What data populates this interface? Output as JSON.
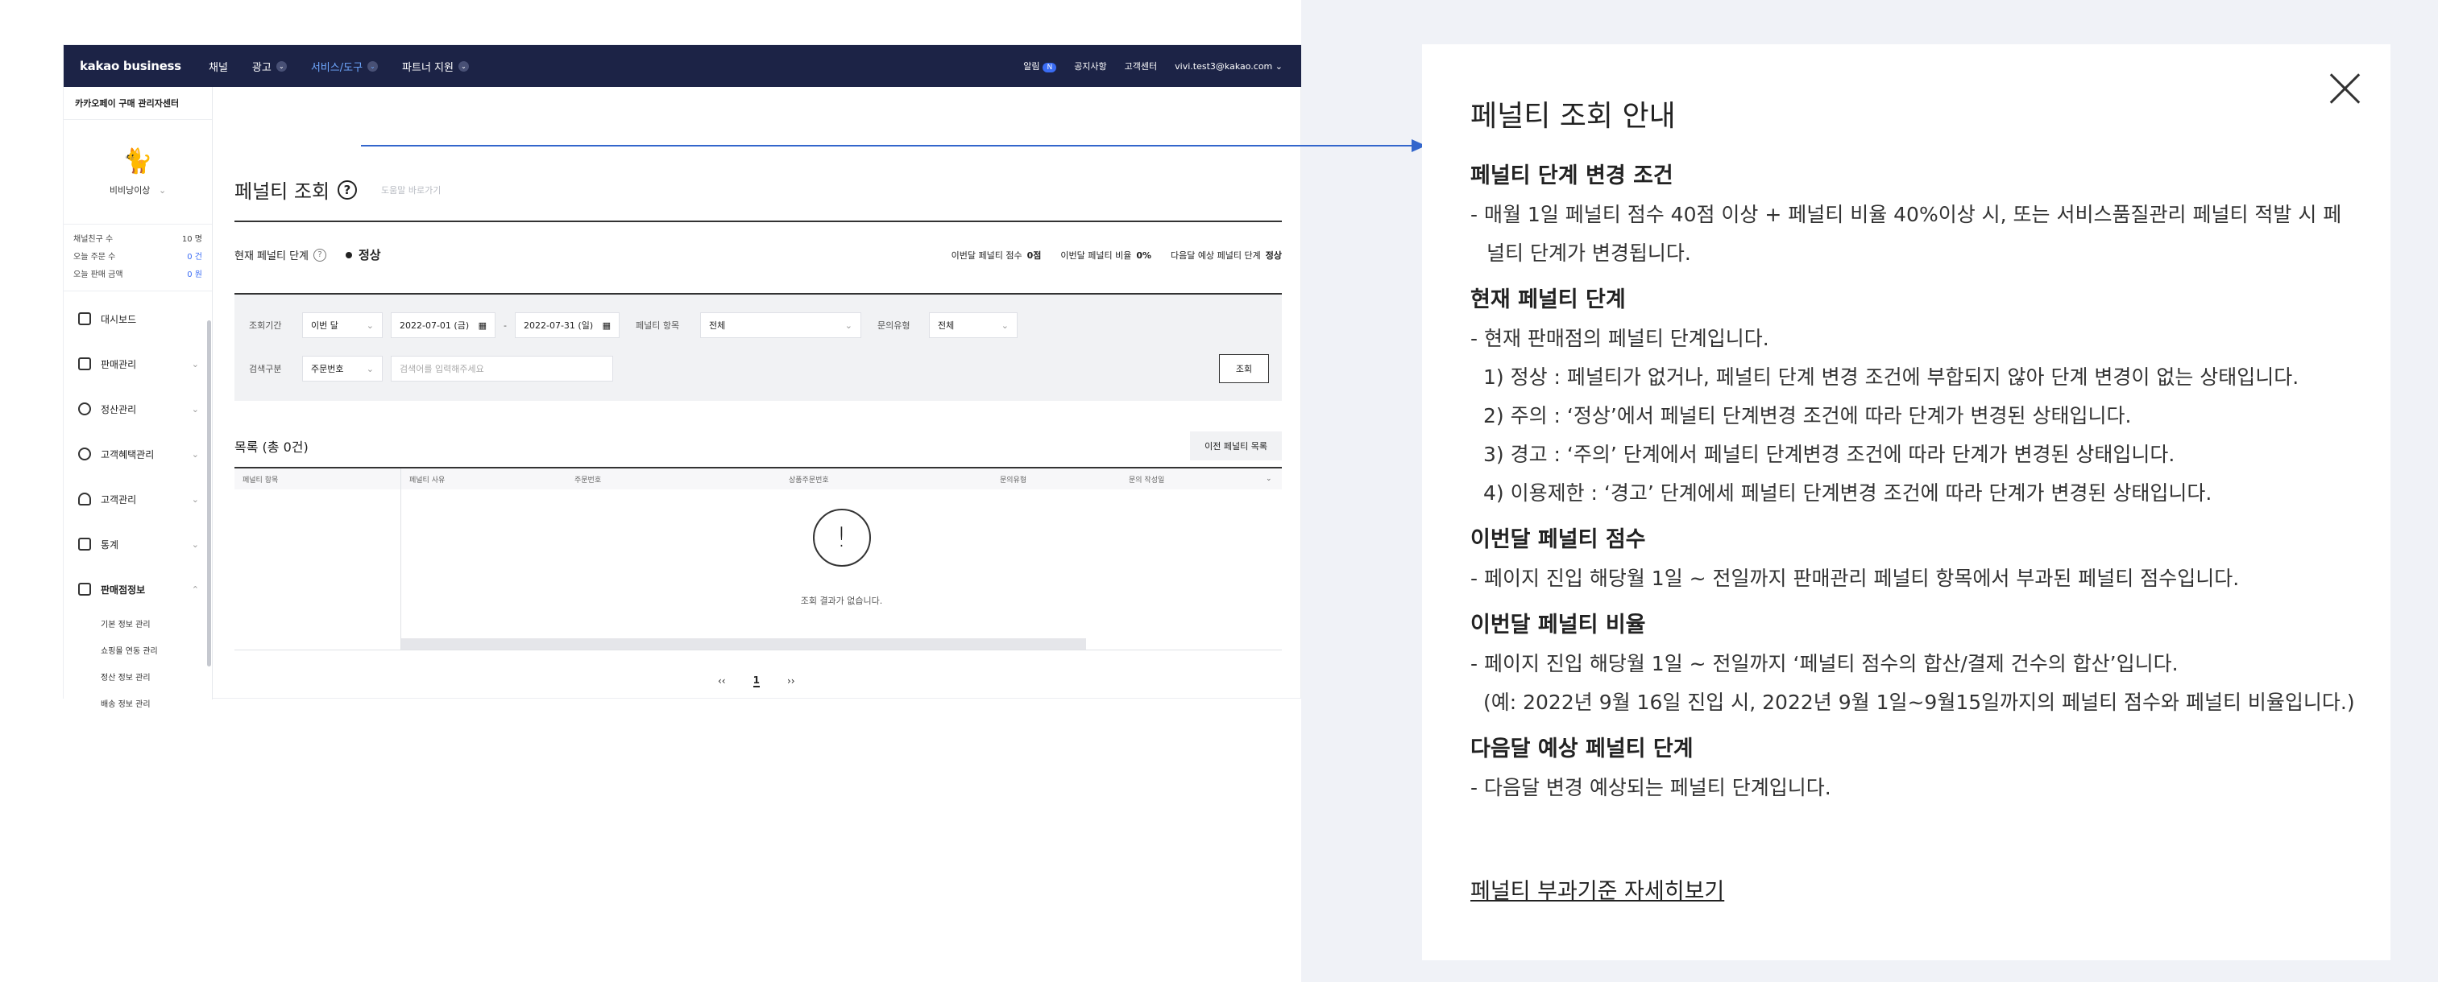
{
  "app": {
    "brand": "kakao business",
    "gnb": [
      {
        "label": "채널",
        "chevron": false,
        "active": false
      },
      {
        "label": "광고",
        "chevron": true,
        "active": false
      },
      {
        "label": "서비스/도구",
        "chevron": true,
        "active": true
      },
      {
        "label": "파트너 지원",
        "chevron": true,
        "active": false
      }
    ],
    "util": {
      "alarm_label": "알림",
      "alarm_count": "N",
      "notice": "공지사항",
      "support": "고객센터",
      "account": "vivi.test3@kakao.com"
    },
    "sidebar": {
      "title": "카카오페이 구매 관리자센터",
      "nickname": "비비낭이상",
      "stats": [
        {
          "label": "채널친구 수",
          "value": "10 명",
          "blue": false
        },
        {
          "label": "오늘 주문 수",
          "value": "0 건",
          "blue": true
        },
        {
          "label": "오늘 판매 금액",
          "value": "0 원",
          "blue": true
        }
      ],
      "menu": [
        {
          "label": "대시보드"
        },
        {
          "label": "판매관리"
        },
        {
          "label": "정산관리"
        },
        {
          "label": "고객혜택관리"
        },
        {
          "label": "고객관리"
        },
        {
          "label": "통계"
        },
        {
          "label": "판매점정보"
        }
      ],
      "submenu": [
        "기본 정보 관리",
        "쇼핑몰 연동 관리",
        "정산 정보 관리",
        "배송 정보 관리"
      ]
    },
    "page": {
      "title": "페널티 조회",
      "faint_link": "도움말 바로가기",
      "status_label": "현재 페널티 단계",
      "status_value": "정상",
      "month_score_label": "이번달 페널티 점수",
      "month_score": "0점",
      "month_ratio_label": "이번달 페널티 비율",
      "month_ratio": "0%",
      "next_level_label": "다음달 예상 페널티 단계",
      "next_level": "정상"
    },
    "filter": {
      "period_label": "조회기간",
      "period_value": "이번 달",
      "date_from": "2022-07-01 (금)",
      "date_sep": "-",
      "date_to": "2022-07-31 (일)",
      "penalty_item_label": "페널티 항목",
      "penalty_item_value": "전체",
      "inquiry_type_label": "문의유형",
      "inquiry_type_value": "전체",
      "search_type_label": "검색구분",
      "search_type_value": "주문번호",
      "search_placeholder": "검색어를 입력해주세요",
      "search_button": "조회"
    },
    "list": {
      "title": "목록 (총 0건)",
      "prev_button": "이전 페널티 목록",
      "columns": [
        "페널티 항목",
        "페널티 사유",
        "주문번호",
        "상품주문번호",
        "문의유형",
        "문의 작성일"
      ],
      "empty_text": "조회 결과가 없습니다.",
      "pager": {
        "prev": "‹‹",
        "page": "1",
        "next": "››"
      }
    }
  },
  "panel": {
    "title": "페널티 조회 안내",
    "sections": [
      {
        "heading": "페널티 단계 변경 조건",
        "lines": [
          "- 매월 1일 페널티 점수 40점 이상 + 페널티 비율 40%이상 시, 또는 서비스품질관리 페널티 적발 시 페",
          "널티 단계가 변경됩니다."
        ]
      },
      {
        "heading": "현재 페널티 단계",
        "lines": [
          "- 현재 판매점의 페널티 단계입니다.",
          "1) 정상 : 페널티가 없거나, 페널티 단계 변경 조건에 부합되지 않아 단계 변경이 없는 상태입니다.",
          "2) 주의 : ‘정상’에서 페널티 단계변경 조건에 따라 단계가 변경된 상태입니다.",
          "3) 경고 : ‘주의’ 단계에서 페널티 단계변경 조건에 따라 단계가 변경된 상태입니다.",
          "4) 이용제한 : ‘경고’ 단계에세 페널티 단계변경 조건에 따라 단계가 변경된 상태입니다."
        ]
      },
      {
        "heading": "이번달 페널티 점수",
        "lines": [
          "- 페이지 진입 해당월 1일 ~ 전일까지 판매관리 페널티 항목에서 부과된 페널티 점수입니다."
        ]
      },
      {
        "heading": "이번달 페널티 비율",
        "lines": [
          "- 페이지 진입 해당월 1일 ~ 전일까지 ‘페널티 점수의 합산/결제 건수의 합산’입니다.",
          "(예: 2022년 9월 16일 진입 시, 2022년 9월 1일~9월15일까지의 페널티 점수와 페널티 비율입니다.)"
        ]
      },
      {
        "heading": "다음달 예상 페널티 단계",
        "lines": [
          "- 다음달 변경 예상되는 페널티 단계입니다."
        ]
      }
    ],
    "more_link": "페널티 부과기준 자세히보기"
  }
}
